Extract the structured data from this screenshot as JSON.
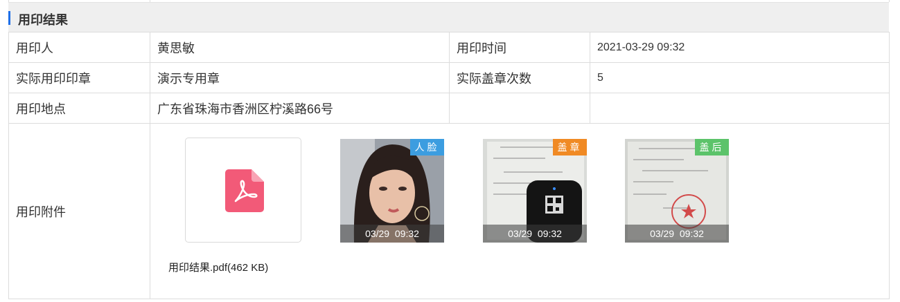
{
  "section": {
    "title": "用印结果"
  },
  "rows": {
    "user": {
      "label": "用印人",
      "value": "黄思敏",
      "label2": "用印时间",
      "value2": "2021-03-29 09:32"
    },
    "seal": {
      "label": "实际用印印章",
      "value": "演示专用章",
      "label2": "实际盖章次数",
      "value2": "5"
    },
    "place": {
      "label": "用印地点",
      "value": "广东省珠海市香洲区柠溪路66号"
    },
    "attach": {
      "label": "用印附件"
    }
  },
  "attachments": {
    "pdf": {
      "name": "用印结果.pdf(462 KB)",
      "icon": "pdf-icon",
      "color": "#f25a78"
    },
    "photos": [
      {
        "tag": "人脸",
        "tag_color": "#3c9de0",
        "time": "03/29  09:32"
      },
      {
        "tag": "盖章",
        "tag_color": "#f08a24",
        "time": "03/29  09:32"
      },
      {
        "tag": "盖后",
        "tag_color": "#5cc36a",
        "time": "03/29  09:32"
      }
    ]
  }
}
